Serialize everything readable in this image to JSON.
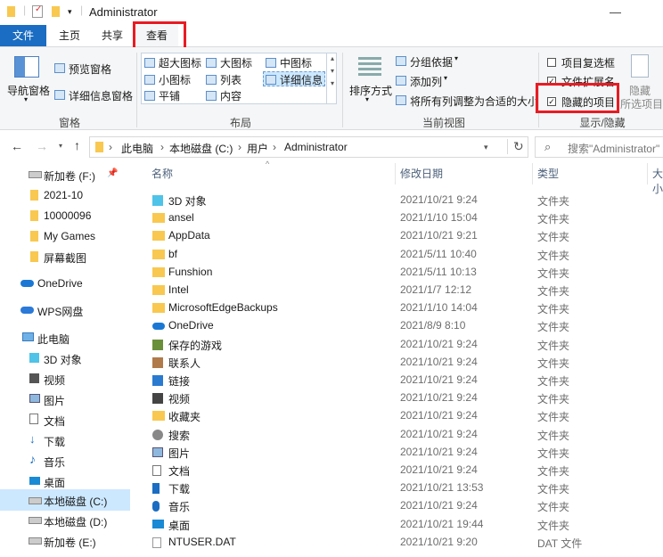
{
  "window": {
    "title": "Administrator",
    "minimize_icon": "minimize-icon",
    "close_icon": "close-icon"
  },
  "tabs": [
    {
      "label": "文件"
    },
    {
      "label": "主页"
    },
    {
      "label": "共享"
    },
    {
      "label": "查看"
    }
  ],
  "ribbon": {
    "panes": {
      "nav_pane": "导航窗格",
      "preview_pane": "预览窗格",
      "details_pane": "详细信息窗格",
      "group": "窗格"
    },
    "layout": {
      "extra_large": "超大图标",
      "large": "大图标",
      "medium": "中图标",
      "small": "小图标",
      "list": "列表",
      "details": "详细信息",
      "tiles": "平铺",
      "content": "内容",
      "group": "布局"
    },
    "current_view": {
      "sort_by": "排序方式",
      "group_by": "分组依据",
      "add_columns": "添加列",
      "size_all_columns": "将所有列调整为合适的大小",
      "group": "当前视图"
    },
    "show_hide": {
      "item_checkboxes": "项目复选框",
      "file_extensions": "文件扩展名",
      "hidden_items": "隐藏的项目",
      "hide_selected_line1": "隐藏",
      "hide_selected_line2": "所选项目",
      "group": "显示/隐藏"
    }
  },
  "address": {
    "path": [
      "此电脑",
      "本地磁盘 (C:)",
      "用户",
      "Administrator"
    ],
    "search_placeholder": "搜索\"Administrator\""
  },
  "nav_pane": {
    "items": [
      {
        "label": "新加卷 (F:)"
      },
      {
        "label": "2021-10"
      },
      {
        "label": "10000096"
      },
      {
        "label": "My Games"
      },
      {
        "label": "屏幕截图"
      },
      {
        "label": "OneDrive"
      },
      {
        "label": "WPS网盘"
      },
      {
        "label": "此电脑"
      },
      {
        "label": "3D 对象"
      },
      {
        "label": "视频"
      },
      {
        "label": "图片"
      },
      {
        "label": "文档"
      },
      {
        "label": "下载"
      },
      {
        "label": "音乐"
      },
      {
        "label": "桌面"
      },
      {
        "label": "本地磁盘 (C:)"
      },
      {
        "label": "本地磁盘 (D:)"
      },
      {
        "label": "新加卷 (E:)"
      }
    ]
  },
  "columns": {
    "name": "名称",
    "date": "修改日期",
    "type": "类型",
    "size": "大小"
  },
  "files": [
    {
      "name": "3D 对象",
      "date": "2021/10/21 9:24",
      "type": "文件夹",
      "icon": "3d-objects-icon"
    },
    {
      "name": "ansel",
      "date": "2021/1/10 15:04",
      "type": "文件夹",
      "icon": "folder-icon"
    },
    {
      "name": "AppData",
      "date": "2021/10/21 9:21",
      "type": "文件夹",
      "icon": "folder-icon"
    },
    {
      "name": "bf",
      "date": "2021/5/11 10:40",
      "type": "文件夹",
      "icon": "folder-icon"
    },
    {
      "name": "Funshion",
      "date": "2021/5/11 10:13",
      "type": "文件夹",
      "icon": "folder-icon"
    },
    {
      "name": "Intel",
      "date": "2021/1/7 12:12",
      "type": "文件夹",
      "icon": "folder-icon"
    },
    {
      "name": "MicrosoftEdgeBackups",
      "date": "2021/1/10 14:04",
      "type": "文件夹",
      "icon": "folder-icon"
    },
    {
      "name": "OneDrive",
      "date": "2021/8/9 8:10",
      "type": "文件夹",
      "icon": "onedrive-icon"
    },
    {
      "name": "保存的游戏",
      "date": "2021/10/21 9:24",
      "type": "文件夹",
      "icon": "saved-games-icon"
    },
    {
      "name": "联系人",
      "date": "2021/10/21 9:24",
      "type": "文件夹",
      "icon": "contacts-icon"
    },
    {
      "name": "链接",
      "date": "2021/10/21 9:24",
      "type": "文件夹",
      "icon": "links-icon"
    },
    {
      "name": "视频",
      "date": "2021/10/21 9:24",
      "type": "文件夹",
      "icon": "videos-icon"
    },
    {
      "name": "收藏夹",
      "date": "2021/10/21 9:24",
      "type": "文件夹",
      "icon": "favorites-icon"
    },
    {
      "name": "搜索",
      "date": "2021/10/21 9:24",
      "type": "文件夹",
      "icon": "searches-icon"
    },
    {
      "name": "图片",
      "date": "2021/10/21 9:24",
      "type": "文件夹",
      "icon": "pictures-icon"
    },
    {
      "name": "文档",
      "date": "2021/10/21 9:24",
      "type": "文件夹",
      "icon": "documents-icon"
    },
    {
      "name": "下载",
      "date": "2021/10/21 13:53",
      "type": "文件夹",
      "icon": "downloads-icon"
    },
    {
      "name": "音乐",
      "date": "2021/10/21 9:24",
      "type": "文件夹",
      "icon": "music-icon"
    },
    {
      "name": "桌面",
      "date": "2021/10/21 19:44",
      "type": "文件夹",
      "icon": "desktop-icon"
    },
    {
      "name": "NTUSER.DAT",
      "date": "2021/10/21 9:20",
      "type": "DAT 文件",
      "icon": "file-icon"
    }
  ]
}
